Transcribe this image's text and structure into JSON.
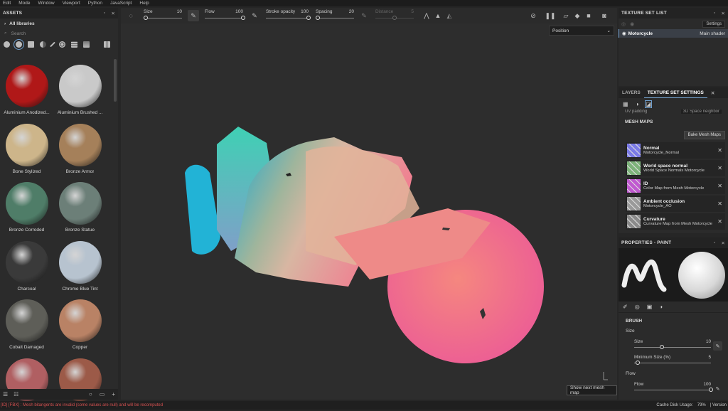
{
  "menu": [
    "Edit",
    "Mode",
    "Window",
    "Viewport",
    "Python",
    "JavaScript",
    "Help"
  ],
  "assets": {
    "title": "ASSETS",
    "library": "All libraries",
    "search_placeholder": "Search",
    "materials": [
      {
        "name": "Aluminium Anodized...",
        "color": "#b01818"
      },
      {
        "name": "Aluminium Brushed ...",
        "color": "#c9c9c9"
      },
      {
        "name": "Bone Stylized",
        "color": "#cdb58a"
      },
      {
        "name": "Bronze Armor",
        "color": "#a5805a"
      },
      {
        "name": "Bronze Corroded",
        "color": "#4f7d68"
      },
      {
        "name": "Bronze Statue",
        "color": "#6c7f78"
      },
      {
        "name": "Charcoal",
        "color": "#3a3a3a"
      },
      {
        "name": "Chrome Blue Tint",
        "color": "#b7c3cf"
      },
      {
        "name": "Cobalt Damaged",
        "color": "#5e5e58"
      },
      {
        "name": "Copper",
        "color": "#b98265"
      },
      {
        "name": "",
        "color": "#b05f62"
      },
      {
        "name": "",
        "color": "#9c5a48"
      }
    ]
  },
  "toolbar": {
    "size": {
      "label": "Size",
      "value": "10",
      "fraction": 0.06
    },
    "flow": {
      "label": "Flow",
      "value": "100",
      "fraction": 1.0
    },
    "stroke_opacity": {
      "label": "Stroke opacity",
      "value": "100",
      "fraction": 1.0
    },
    "spacing": {
      "label": "Spacing",
      "value": "20",
      "fraction": 0.05
    },
    "distance": {
      "label": "Distance",
      "value": "5",
      "fraction": 0.5
    }
  },
  "viewport": {
    "mode_select": "Position",
    "tooltip": "Show next mesh map"
  },
  "texture_set_list": {
    "title": "TEXTURE SET LIST",
    "settings_label": "Settings",
    "row_name": "Motorcycle",
    "row_shader": "Main shader"
  },
  "tabs": {
    "layers": "LAYERS",
    "texture_set_settings": "TEXTURE SET SETTINGS"
  },
  "texture_set_settings": {
    "uv_label": "UV padding",
    "uv_value": "3D Space neighbor",
    "mesh_maps_title": "MESH MAPS",
    "bake_label": "Bake Mesh Maps",
    "maps": [
      {
        "name": "Normal",
        "detail": "Motorcycle_Normal",
        "color": "#7a7ae6"
      },
      {
        "name": "World space normal",
        "detail": "World Space Normals Motorcycle",
        "color": "#7db37a"
      },
      {
        "name": "ID",
        "detail": "Color Map from Mesh Motorcycle",
        "color": "#c05ad0"
      },
      {
        "name": "Ambient occlusion",
        "detail": "Motorcycle_AO",
        "color": "#9a9a9a"
      },
      {
        "name": "Curvature",
        "detail": "Curvature Map from Mesh Motorcycle",
        "color": "#8a8a8a"
      }
    ]
  },
  "properties": {
    "title": "PROPERTIES - PAINT",
    "brush_title": "BRUSH",
    "size_section": "Size",
    "size": {
      "label": "Size",
      "value": "10",
      "fraction": 0.36
    },
    "min_size": {
      "label": "Minimum Size (%)",
      "value": "5",
      "fraction": 0.05
    },
    "flow_section": "Flow",
    "flow": {
      "label": "Flow",
      "value": "100",
      "fraction": 1.0
    }
  },
  "status": {
    "error": "[ID] [FBX] : Mesh bitangents are invalid (some values are null) and will be recomputed",
    "cache_label": "Cache Disk Usage:",
    "cache_value": "79%",
    "version": "| Version"
  }
}
